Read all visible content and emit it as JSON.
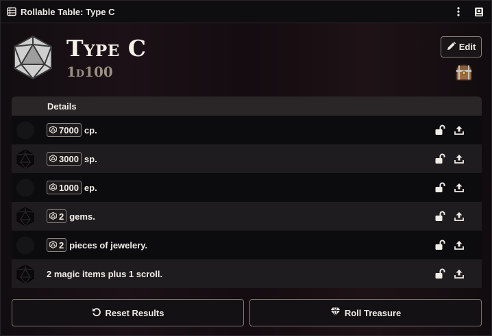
{
  "window": {
    "title": "Rollable Table: Type C"
  },
  "table": {
    "name": "Type C",
    "formula": "1d100",
    "edit_label": "Edit",
    "header_details": "Details"
  },
  "results": [
    {
      "roll": "7000",
      "text": "cp.",
      "shaded": false
    },
    {
      "roll": "3000",
      "text": "sp.",
      "shaded": true
    },
    {
      "roll": "1000",
      "text": "ep.",
      "shaded": false
    },
    {
      "roll": "2",
      "text": "gems.",
      "shaded": true
    },
    {
      "roll": "2",
      "text": "pieces of jewelery.",
      "shaded": false
    },
    {
      "roll": "",
      "text": "2 magic items plus 1 scroll.",
      "shaded": true
    }
  ],
  "footer": {
    "reset_label": "Reset Results",
    "roll_label": "Roll Treasure"
  },
  "colors": {
    "background": "#140c10",
    "row_dark": "#0c0b0e",
    "row_light": "#1e1c1f",
    "text": "#f2eee8",
    "accent_muted": "#9a8f83"
  },
  "icons": {
    "title": "table-list-icon",
    "menu": "kebab-menu-icon",
    "sheet": "sheet-toggle-icon",
    "die": "d20-icon",
    "edit": "pencil-icon",
    "chest": "treasure-chest-icon",
    "lock": "unlock-icon",
    "export": "upload-icon",
    "reset": "reset-icon",
    "gem": "gem-icon"
  }
}
